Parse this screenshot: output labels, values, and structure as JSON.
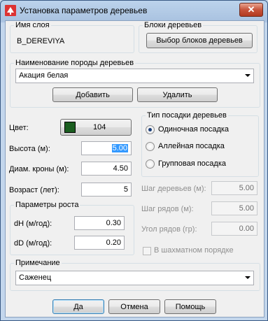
{
  "window": {
    "title": "Установка параметров деревьев",
    "close_label": "✕"
  },
  "layer": {
    "legend": "Имя слоя",
    "value": "B_DEREVIYA"
  },
  "blocks": {
    "legend": "Блоки деревьев",
    "button": "Выбор блоков деревьев"
  },
  "species": {
    "legend": "Наименование породы деревьев",
    "selected": "Акация белая",
    "add_button": "Добавить",
    "delete_button": "Удалить"
  },
  "params": {
    "color_label": "Цвет:",
    "color_value": "104",
    "color_swatch": "#1b5e20",
    "height_label": "Высота (м):",
    "height_value": "5.00",
    "crown_label": "Диам. кроны (м):",
    "crown_value": "4.50",
    "age_label": "Возраст (лет):",
    "age_value": "5"
  },
  "planting": {
    "legend": "Тип посадки деревьев",
    "options": [
      "Одиночная посадка",
      "Аллейная посадка",
      "Групповая посадка"
    ],
    "selected_index": 0
  },
  "growth": {
    "legend": "Параметры роста",
    "dh_label": "dH (м/год):",
    "dh_value": "0.30",
    "dd_label": "dD (м/год):",
    "dd_value": "0.20"
  },
  "spacing": {
    "tree_step_label": "Шаг деревьев (м):",
    "tree_step_value": "5.00",
    "row_step_label": "Шаг рядов (м):",
    "row_step_value": "5.00",
    "row_angle_label": "Угол рядов (гр):",
    "row_angle_value": "0.00",
    "checker_label": "В шахматном порядке"
  },
  "note": {
    "legend": "Примечание",
    "selected": "Саженец"
  },
  "footer": {
    "ok": "Да",
    "cancel": "Отмена",
    "help": "Помощь"
  }
}
